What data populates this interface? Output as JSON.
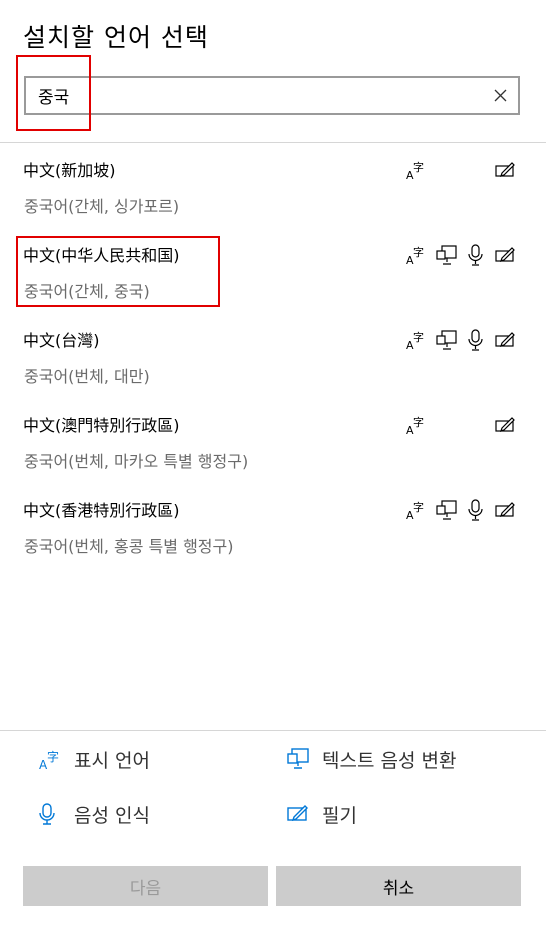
{
  "title": "설치할 언어 선택",
  "search": {
    "value": "중국"
  },
  "languages": [
    {
      "name": "中文(新加坡)",
      "subtitle": "중국어(간체, 싱가포르)",
      "features": [
        "display-language",
        "handwriting"
      ]
    },
    {
      "name": "中文(中华人民共和国)",
      "subtitle": "중국어(간체, 중국)",
      "features": [
        "display-language",
        "text-to-speech",
        "speech-recognition",
        "handwriting"
      ]
    },
    {
      "name": "中文(台灣)",
      "subtitle": "중국어(번체, 대만)",
      "features": [
        "display-language",
        "text-to-speech",
        "speech-recognition",
        "handwriting"
      ]
    },
    {
      "name": "中文(澳門特別行政區)",
      "subtitle": "중국어(번체, 마카오 특별 행정구)",
      "features": [
        "display-language",
        "handwriting"
      ]
    },
    {
      "name": "中文(香港特別行政區)",
      "subtitle": "중국어(번체, 홍콩 특별 행정구)",
      "features": [
        "display-language",
        "text-to-speech",
        "speech-recognition",
        "handwriting"
      ]
    }
  ],
  "legend": {
    "display_language": "표시 언어",
    "text_to_speech": "텍스트 음성 변환",
    "speech_recognition": "음성 인식",
    "handwriting": "필기"
  },
  "buttons": {
    "next": "다음",
    "cancel": "취소"
  },
  "colors": {
    "accent": "#0078d7",
    "highlight": "#e10000",
    "disabled_text": "#9a9a9a"
  }
}
